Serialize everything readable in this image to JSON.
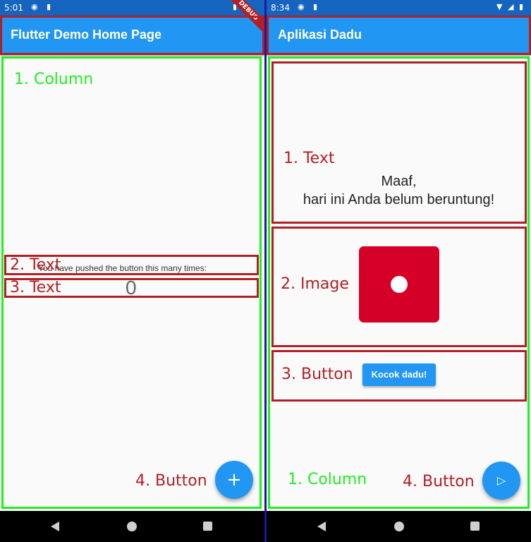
{
  "left": {
    "status": {
      "time": "5:01",
      "icons": [
        "debug-badge-icon",
        "sim-card-icon"
      ]
    },
    "debug_banner": "DEBUG",
    "app_title": "Flutter Demo Home Page",
    "body_text": "You have pushed the button this many times:",
    "counter": "0",
    "fab_symbol": "+",
    "annotations": {
      "column": "1. Column",
      "text1": "2. Text",
      "text2": "3. Text",
      "button": "4. Button"
    }
  },
  "right": {
    "status": {
      "time": "8:34"
    },
    "app_title": "Aplikasi Dadu",
    "message_line1": "Maaf,",
    "message_line2": "hari ini Anda belum beruntung!",
    "button_label": "Kocok dadu!",
    "annotations": {
      "text": "1. Text",
      "image": "2. Image",
      "button": "3. Button",
      "column": "1. Column",
      "fab": "4. Button"
    }
  },
  "colors": {
    "appbar": "#2196f3",
    "statusbar": "#1565c0",
    "annotation_green": "#22ee22",
    "annotation_red": "#b21f25",
    "dice": "#d50027"
  }
}
